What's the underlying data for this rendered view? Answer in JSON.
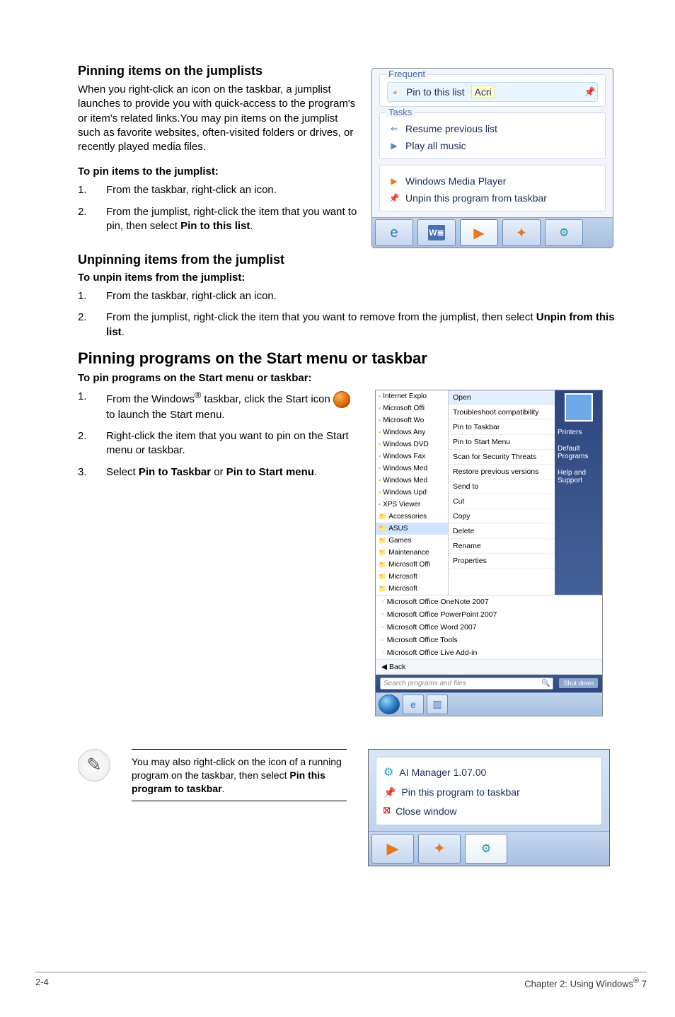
{
  "headings": {
    "pin_jl": "Pinning items on the jumplists",
    "unpin_jl": "Unpinning items from the jumplist",
    "pin_start": "Pinning programs on the Start menu or taskbar"
  },
  "subheads": {
    "to_pin_jl": "To pin items to the jumplist:",
    "to_unpin_jl": "To unpin items from the jumplist:",
    "to_pin_start": "To pin programs on the Start menu or taskbar:"
  },
  "body": {
    "pin_jl_intro": "When you right-click an icon on the taskbar, a jumplist launches to provide you with quick-access to the program's or item's related links.You may pin items on the jumplist such as favorite websites, often-visited folders or drives, or recently played media files."
  },
  "steps": {
    "pin_jl_1": "From the taskbar, right-click an icon.",
    "pin_jl_2a": "From the jumplist, right-click the item that you want to pin, then select ",
    "pin_jl_2b": "Pin to this list",
    "unpin_jl_1": "From the taskbar, right-click an icon.",
    "unpin_jl_2a": "From the jumplist, right-click the item that you want to remove from the jumplist, then select ",
    "unpin_jl_2b": "Unpin from this list",
    "start_1a": "From the Windows",
    "start_1b": " taskbar, click the Start icon ",
    "start_1c": " to launch the Start menu.",
    "start_2": "Right-click the item that you want to pin on the Start menu or taskbar.",
    "start_3a": "Select ",
    "start_3b": "Pin to Taskbar",
    "start_3c": " or ",
    "start_3d": "Pin to Start menu"
  },
  "jumplist_fig": {
    "group_frequent": "Frequent",
    "pin_to_list": "Pin to this list",
    "acri": "Acri",
    "group_tasks": "Tasks",
    "resume": "Resume previous list",
    "play_all": "Play all music",
    "wmp": "Windows Media Player",
    "unpin_taskbar": "Unpin this program from taskbar"
  },
  "startmenu_fig": {
    "left": [
      "Internet Explo",
      "Microsoft Offi",
      "Microsoft Wo",
      "Windows Any",
      "Windows DVD",
      "Windows Fax",
      "Windows Med",
      "Windows Med",
      "Windows Upd",
      "XPS Viewer",
      "Accessories",
      "ASUS",
      "Games",
      "Maintenance",
      "Microsoft Offi",
      "Microsoft",
      "Microsoft"
    ],
    "asus_idx": 11,
    "mid": [
      "Open",
      "Troubleshoot compatibility",
      "Pin to Taskbar",
      "Pin to Start Menu",
      "Scan for Security Threats",
      "Restore previous versions",
      "Send to",
      "Cut",
      "Copy",
      "Delete",
      "Rename",
      "Properties"
    ],
    "right": [
      "Printers",
      "Default Programs",
      "Help and Support"
    ],
    "bottom": [
      "Microsoft Office OneNote 2007",
      "Microsoft Office PowerPoint 2007",
      "Microsoft Office Word 2007",
      "Microsoft Office Tools",
      "Microsoft Office Live Add-in"
    ],
    "back": "Back",
    "search_placeholder": "Search programs and files",
    "shutdown": "Shut down"
  },
  "note": {
    "text_a": "You may also right-click on the icon of a running program on the taskbar, then select ",
    "text_b": "Pin this program to taskbar"
  },
  "ctx_fig": {
    "title": "AI Manager 1.07.00",
    "pin": "Pin this program to taskbar",
    "close": "Close window"
  },
  "footer": {
    "left": "2-4",
    "right_a": "Chapter 2: Using Windows",
    "right_b": " 7"
  }
}
